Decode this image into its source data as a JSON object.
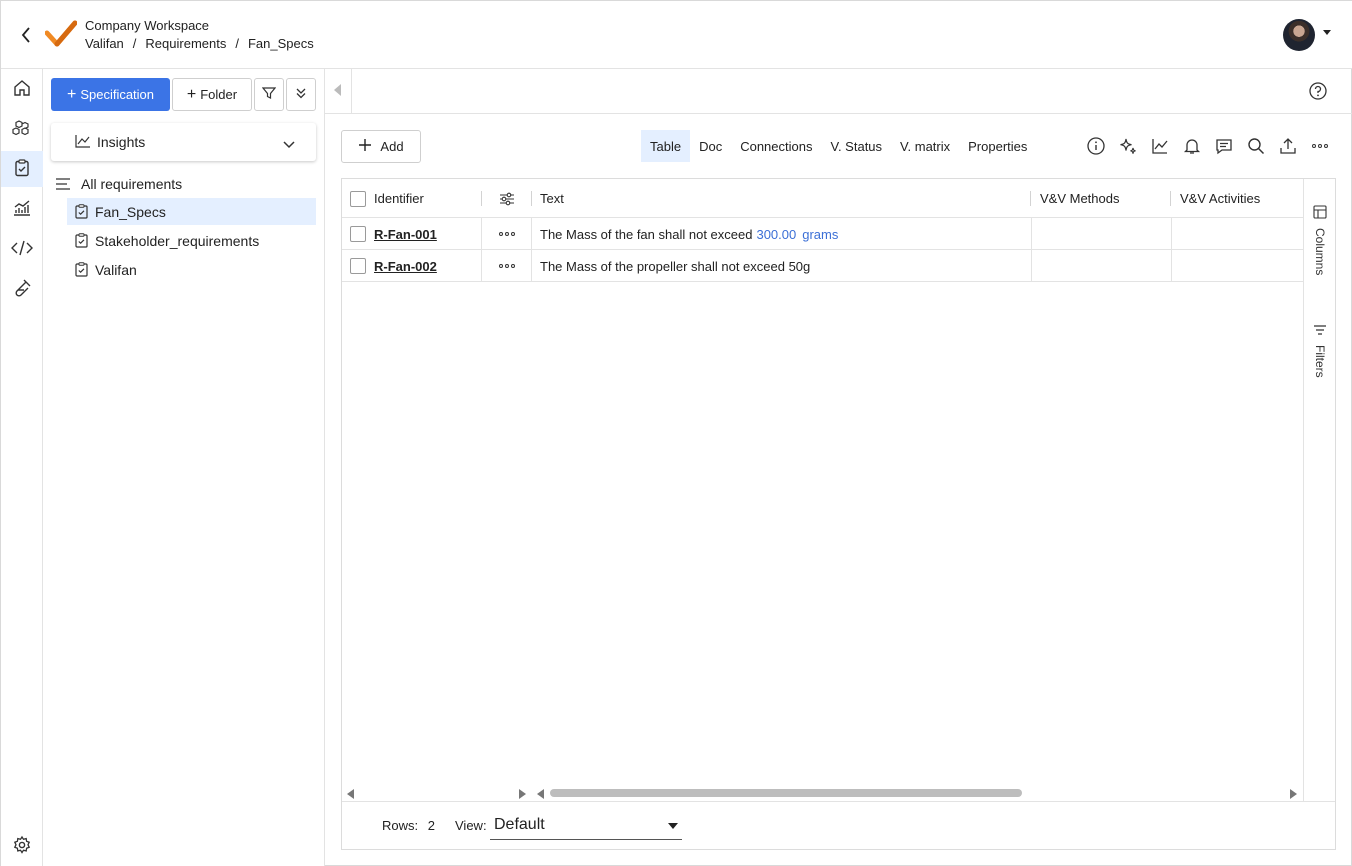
{
  "header": {
    "workspace": "Company Workspace",
    "breadcrumbs": [
      "Valifan",
      "Requirements",
      "Fan_Specs"
    ]
  },
  "rail": {
    "items": [
      "home-icon",
      "cubes-icon",
      "clipboard-check-icon",
      "chart-icon",
      "code-icon",
      "test-tube-icon",
      "settings-icon"
    ]
  },
  "sidebar": {
    "new_spec_label": "Specification",
    "new_folder_label": "Folder",
    "insights_label": "Insights",
    "all_label": "All requirements",
    "items": [
      {
        "label": "Fan_Specs"
      },
      {
        "label": "Stakeholder_requirements"
      },
      {
        "label": "Valifan"
      }
    ]
  },
  "toolbar": {
    "add_label": "Add",
    "tabs": [
      "Table",
      "Doc",
      "Connections",
      "V. Status",
      "V. matrix",
      "Properties"
    ],
    "active_tab": "Table"
  },
  "table": {
    "columns": [
      "Identifier",
      "Text",
      "V&V Methods",
      "V&V Activities"
    ],
    "rows": [
      {
        "id": "R-Fan-001",
        "text": "The Mass of the fan shall not exceed",
        "value": "300.00",
        "unit": "grams",
        "vv_methods": "",
        "vv_activities": ""
      },
      {
        "id": "R-Fan-002",
        "text": "The Mass of the propeller shall not exceed 50g",
        "vv_methods": "",
        "vv_activities": ""
      }
    ]
  },
  "side_panel": {
    "columns_label": "Columns",
    "filters_label": "Filters"
  },
  "footer": {
    "rows_label": "Rows:",
    "rows_count": "2",
    "view_label": "View:",
    "view_value": "Default"
  },
  "colors": {
    "accent": "#3b74e6",
    "active_bg": "#e4efff",
    "link": "#3b6fd6",
    "logo_orange": "#f08a24"
  }
}
